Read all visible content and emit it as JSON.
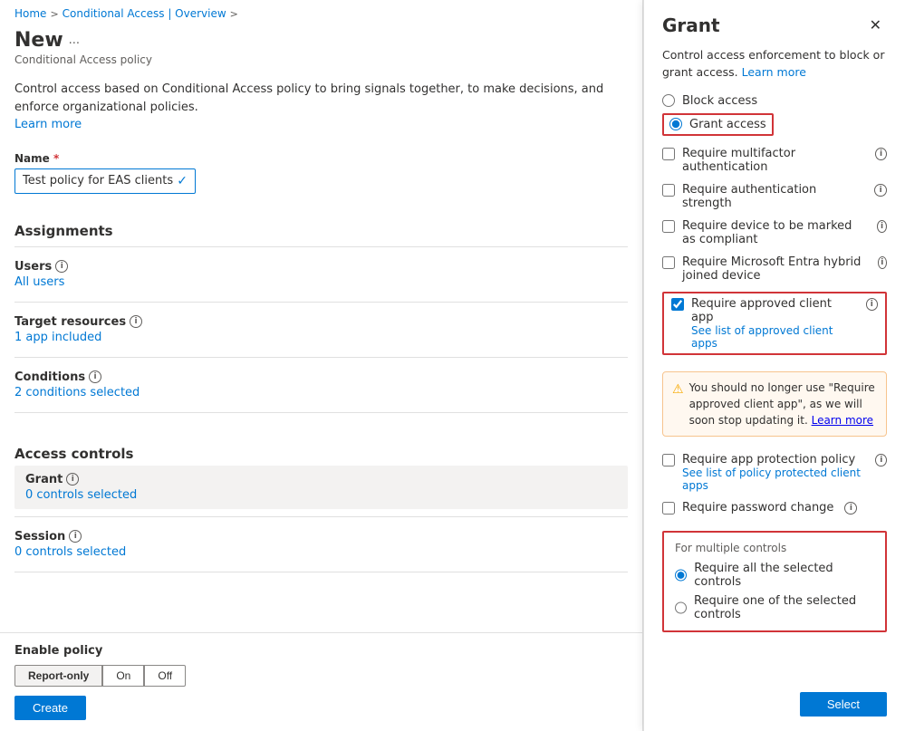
{
  "breadcrumb": {
    "home": "Home",
    "conditional_access": "Conditional Access | Overview",
    "sep1": ">",
    "sep2": ">"
  },
  "page": {
    "title": "New",
    "ellipsis": "...",
    "subtitle": "Conditional Access policy"
  },
  "description": {
    "text": "Control access based on Conditional Access policy to bring signals together, to make decisions, and enforce organizational policies.",
    "learn_more": "Learn more"
  },
  "name_field": {
    "label": "Name",
    "required_marker": "*",
    "value": "Test policy for EAS clients",
    "checkmark": "✓"
  },
  "assignments": {
    "section_title": "Assignments",
    "users": {
      "label": "Users",
      "value": "All users"
    },
    "target_resources": {
      "label": "Target resources",
      "value": "1 app included"
    },
    "conditions": {
      "label": "Conditions",
      "value": "2 conditions selected"
    }
  },
  "access_controls": {
    "section_title": "Access controls",
    "grant": {
      "label": "Grant",
      "value": "0 controls selected"
    },
    "session": {
      "label": "Session",
      "value": "0 controls selected"
    }
  },
  "enable_policy": {
    "label": "Enable policy",
    "options": [
      "Report-only",
      "On",
      "Off"
    ],
    "active": "Report-only"
  },
  "create_button": "Create",
  "grant_panel": {
    "title": "Grant",
    "description": "Control access enforcement to block or grant access.",
    "learn_more": "Learn more",
    "block_access": "Block access",
    "grant_access": "Grant access",
    "checkboxes": [
      {
        "id": "mfa",
        "label": "Require multifactor authentication",
        "checked": false,
        "link": null
      },
      {
        "id": "auth_strength",
        "label": "Require authentication strength",
        "checked": false,
        "link": null
      },
      {
        "id": "compliant",
        "label": "Require device to be marked as compliant",
        "checked": false,
        "link": null
      },
      {
        "id": "hybrid",
        "label": "Require Microsoft Entra hybrid joined device",
        "checked": false,
        "link": null
      },
      {
        "id": "approved_app",
        "label": "Require approved client app",
        "checked": true,
        "link": "See list of approved client apps",
        "highlighted": true
      },
      {
        "id": "app_protection",
        "label": "Require app protection policy",
        "checked": false,
        "link": "See list of policy protected client apps"
      },
      {
        "id": "password_change",
        "label": "Require password change",
        "checked": false,
        "link": null
      }
    ],
    "warning": {
      "text": "You should no longer use \"Require approved client app\", as we will soon stop updating it.",
      "learn_more": "Learn more"
    },
    "multiple_controls": {
      "title": "For multiple controls",
      "options": [
        {
          "id": "require_all",
          "label": "Require all the selected controls",
          "checked": true
        },
        {
          "id": "require_one",
          "label": "Require one of the selected controls",
          "checked": false
        }
      ]
    },
    "select_button": "Select"
  }
}
